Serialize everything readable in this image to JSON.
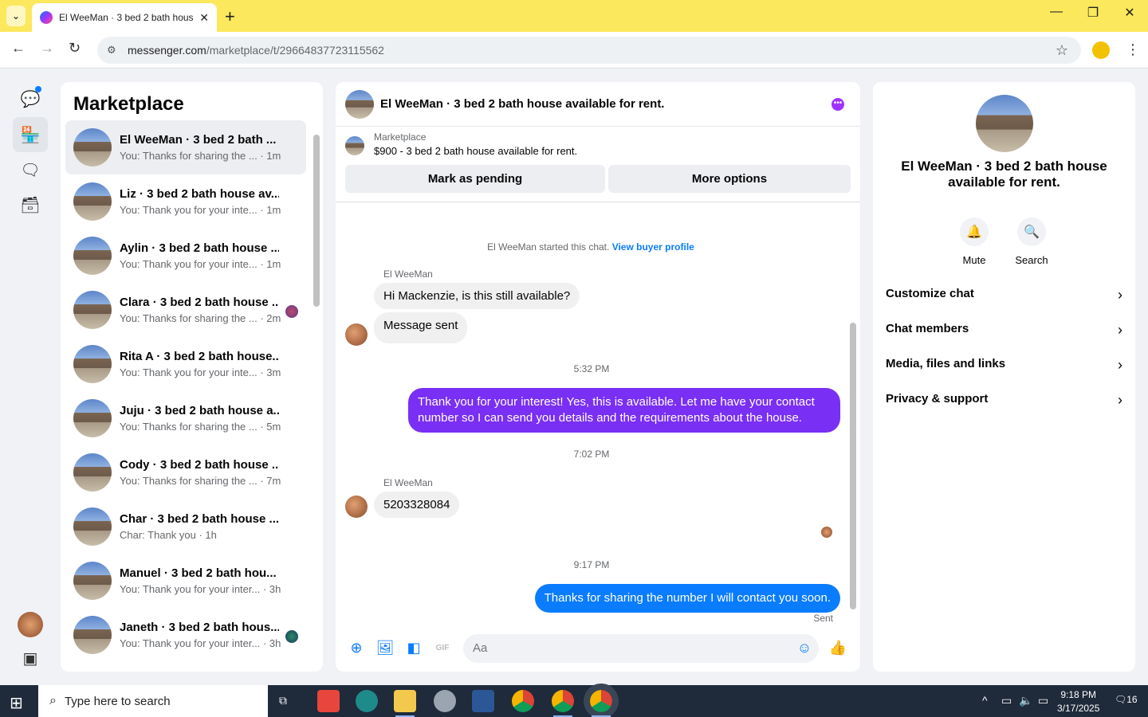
{
  "browser": {
    "tab_title": "El WeeMan · 3 bed 2 bath hous",
    "url_host": "messenger.com",
    "url_path": "/marketplace/t/29664837723115562"
  },
  "list": {
    "title": "Marketplace",
    "conversations": [
      {
        "name": "El WeeMan · 3 bed 2 bath ...",
        "preview": "You: Thanks for sharing the ... · 1m"
      },
      {
        "name": "Liz · 3 bed 2 bath house av...",
        "preview": "You: Thank you for your inte... · 1m"
      },
      {
        "name": "Aylin · 3 bed 2 bath house ...",
        "preview": "You: Thank you for your inte... · 1m"
      },
      {
        "name": "Clara · 3 bed 2 bath house ...",
        "preview": "You: Thanks for sharing the ... · 2m"
      },
      {
        "name": "Rita A · 3 bed 2 bath house...",
        "preview": "You: Thank you for your inte... · 3m"
      },
      {
        "name": "Juju · 3 bed 2 bath house a...",
        "preview": "You: Thanks for sharing the ... · 5m"
      },
      {
        "name": "Cody · 3 bed 2 bath house ...",
        "preview": "You: Thanks for sharing the ... · 7m"
      },
      {
        "name": "Char · 3 bed 2 bath house ...",
        "preview": "Char: Thank you · 1h"
      },
      {
        "name": "Manuel · 3 bed 2 bath hou...",
        "preview": "You: Thank you for your inter... · 3h"
      },
      {
        "name": "Janeth · 3 bed 2 bath hous...",
        "preview": "You: Thank you for your inter... · 3h"
      }
    ]
  },
  "chat": {
    "title": "El WeeMan · 3 bed 2 bath house available for rent.",
    "marketplace_label": "Marketplace",
    "listing": "$900 - 3 bed 2 bath house available for rent.",
    "mark_pending": "Mark as pending",
    "more_options": "More options",
    "started_text": "El WeeMan started this chat.",
    "view_buyer": "View buyer profile",
    "sender_name": "El WeeMan",
    "msg1": "Hi Mackenzie, is this still available?",
    "msg2": "Message sent",
    "ts1": "5:32 PM",
    "msg3": "Thank you for your interest! Yes, this is available. Let me have your contact number so I can send you details and the requirements about the house.",
    "ts2": "7:02 PM",
    "msg4": "5203328084",
    "ts3": "9:17 PM",
    "msg5": "Thanks for sharing the number I will contact you soon.",
    "sent": "Sent",
    "input_placeholder": "Aa"
  },
  "side": {
    "name": "El WeeMan · 3 bed 2 bath house available for rent.",
    "mute": "Mute",
    "search": "Search",
    "options": [
      "Customize chat",
      "Chat members",
      "Media, files and links",
      "Privacy & support"
    ]
  },
  "taskbar": {
    "search_placeholder": "Type here to search",
    "time": "9:18 PM",
    "date": "3/17/2025",
    "notif_count": "16"
  }
}
